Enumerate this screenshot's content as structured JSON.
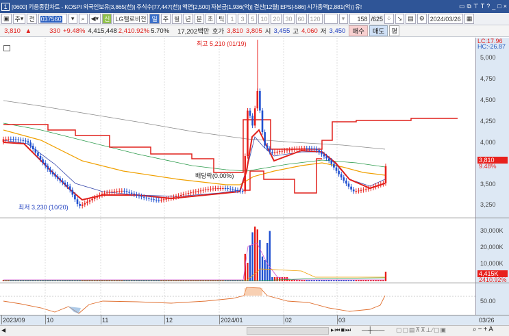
{
  "titlebar": {
    "window_number": "1",
    "title": "[0600] 키움종합차트 - KOSPI 외국인보유[3,865(천)] 주식수[77,447(천)] 액면[2,500] 자본금[1,936(억)] 결산[12월] EPS[-586] 시가총액[2,881(억)] 유!",
    "controls": [
      "restore",
      "new",
      "pin",
      "T",
      "?",
      "minimize",
      "maximize",
      "close"
    ]
  },
  "toolbar": {
    "market": "주",
    "type": "전",
    "code": "037560",
    "stock_name": "LG헬로비전",
    "credit_badge": "신",
    "periods": [
      "일",
      "주",
      "월",
      "년",
      "분",
      "초",
      "틱"
    ],
    "selected_period": "일",
    "intervals": [
      "1",
      "3",
      "5",
      "10",
      "20",
      "30",
      "60",
      "120"
    ],
    "count_current": "158",
    "count_total": "/625",
    "date": "2024/03/26"
  },
  "infobar": {
    "price": "3,810",
    "arrow": "▲",
    "change": "330",
    "change_pct": "+9.48%",
    "volume": "4,415,448",
    "volume_pct": "2,410.92%",
    "turnover": "5.70%",
    "amount": "17,202백만",
    "quote_label": "호가",
    "ask": "3,810",
    "bid": "3,805",
    "open_label": "시",
    "open": "3,455",
    "high_label": "고",
    "high": "4,060",
    "low_label": "저",
    "low": "3,450",
    "buy": "매수",
    "sell": "매도",
    "p": "평"
  },
  "price_axis": {
    "lc": "LC:17.96",
    "hc": "HC:-26.87",
    "ticks": [
      "5,000",
      "4,750",
      "4,500",
      "4,250",
      "4,000",
      "3,500",
      "3,250"
    ],
    "current_price": "3,810",
    "current_pct": "9.48%"
  },
  "volume_axis": {
    "ticks": [
      "30,000K",
      "20,000K",
      "10,000K"
    ],
    "current": "4,415K",
    "current_pct": "2410.92%"
  },
  "indicator_axis": {
    "ticks": [
      "50.00"
    ]
  },
  "annotations": {
    "high": "최고 5,210 (01/19)",
    "low": "최저 3,230 (10/20)",
    "dividend": "배당락(0.00%)"
  },
  "xaxis": {
    "labels": [
      "2023/09",
      "10",
      "11",
      "12",
      "2024/01",
      "02",
      "03"
    ],
    "end_date": "03/26"
  },
  "colors": {
    "up": "#e8201c",
    "down": "#1f4fd0",
    "titlebar": "#2f5597",
    "axis_bg": "#dde8f4"
  }
}
